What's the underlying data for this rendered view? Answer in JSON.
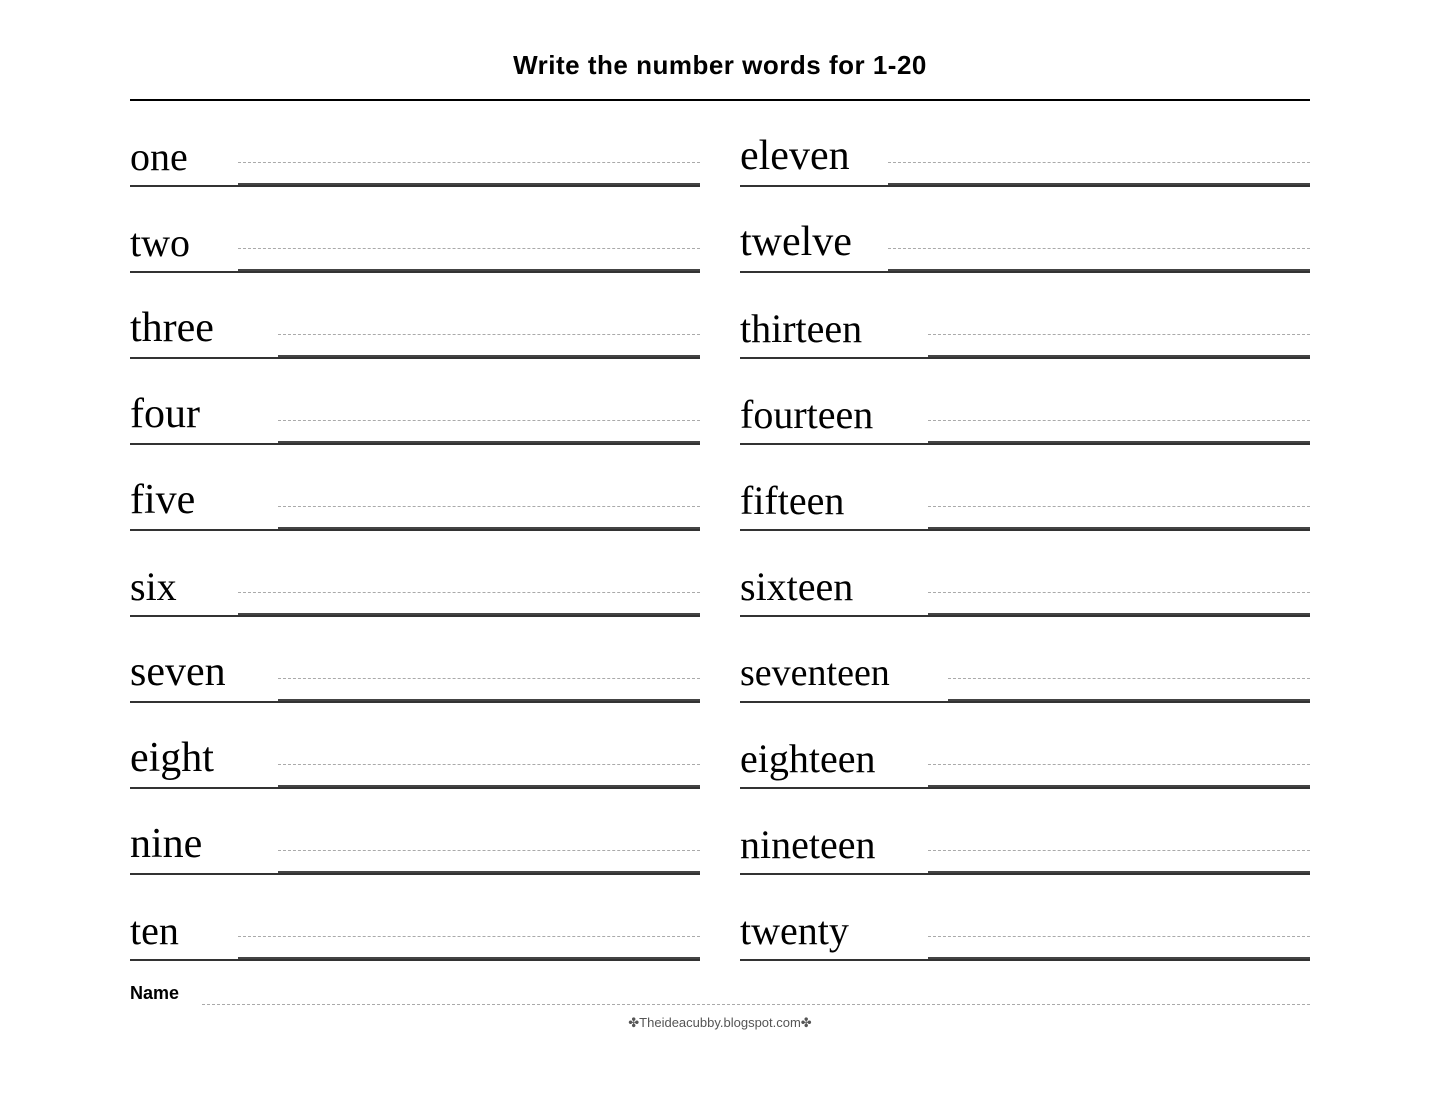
{
  "title": "Write the number words for  1-20",
  "left_column": [
    {
      "word": "one",
      "size": "small"
    },
    {
      "word": "two",
      "size": "small"
    },
    {
      "word": "three",
      "size": "medium"
    },
    {
      "word": "four",
      "size": "medium"
    },
    {
      "word": "five",
      "size": "medium"
    },
    {
      "word": "six",
      "size": "small"
    },
    {
      "word": "seven",
      "size": "medium"
    },
    {
      "word": "eight",
      "size": "medium"
    },
    {
      "word": "nine",
      "size": "medium"
    },
    {
      "word": "ten",
      "size": "small"
    }
  ],
  "right_column": [
    {
      "word": "eleven",
      "size": "medium"
    },
    {
      "word": "twelve",
      "size": "medium"
    },
    {
      "word": "thirteen",
      "size": "large"
    },
    {
      "word": "fourteen",
      "size": "large"
    },
    {
      "word": "fifteen",
      "size": "large"
    },
    {
      "word": "sixteen",
      "size": "large"
    },
    {
      "word": "seventeen",
      "size": "xlarge"
    },
    {
      "word": "eighteen",
      "size": "large"
    },
    {
      "word": "nineteen",
      "size": "large"
    },
    {
      "word": "twenty",
      "size": "large"
    }
  ],
  "name_label": "Name",
  "footer": "✤Theideacubby.blogspot.com✤"
}
